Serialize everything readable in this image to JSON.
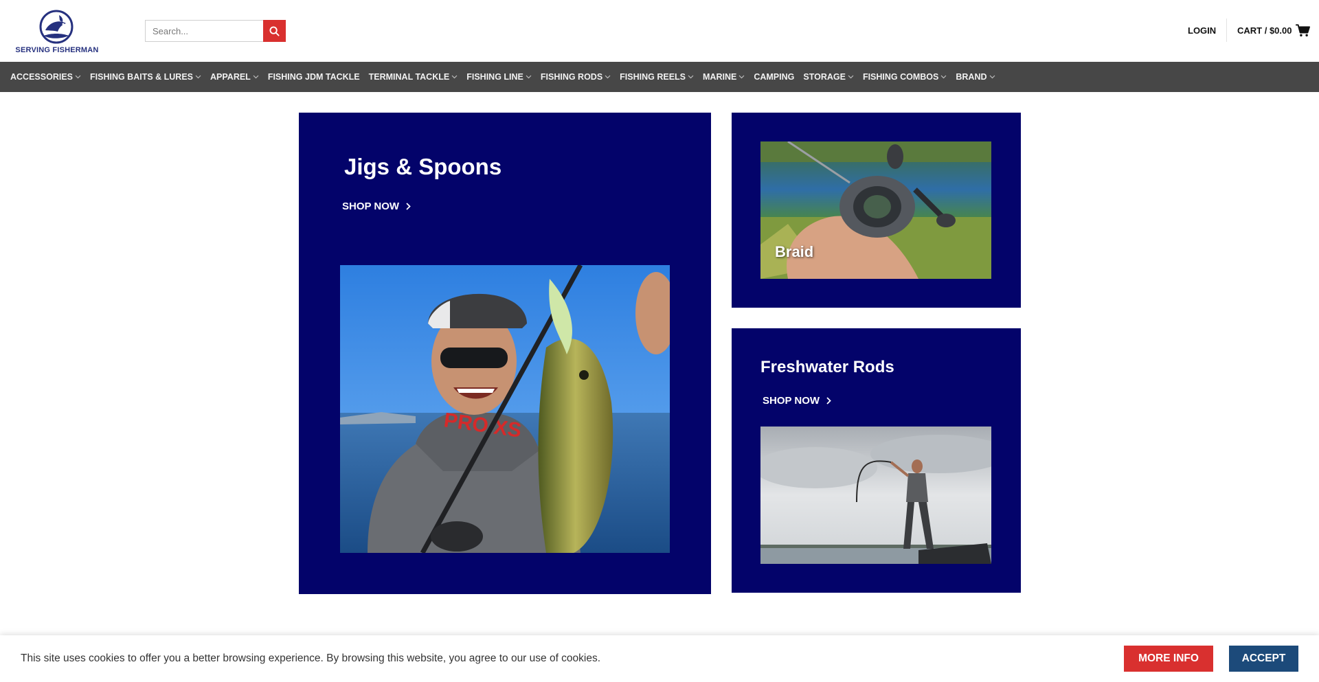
{
  "header": {
    "logo_text": "SERVING FISHERMAN",
    "search": {
      "placeholder": "Search..."
    },
    "login_label": "LOGIN",
    "cart_label": "CART / $0.00"
  },
  "nav": {
    "items": [
      {
        "label": "ACCESSORIES",
        "has_dropdown": true
      },
      {
        "label": "FISHING BAITS & LURES",
        "has_dropdown": true
      },
      {
        "label": "APPAREL",
        "has_dropdown": true
      },
      {
        "label": "FISHING JDM TACKLE",
        "has_dropdown": false
      },
      {
        "label": "TERMINAL TACKLE",
        "has_dropdown": true
      },
      {
        "label": "FISHING LINE",
        "has_dropdown": true
      },
      {
        "label": "FISHING RODS",
        "has_dropdown": true
      },
      {
        "label": "FISHING REELS",
        "has_dropdown": true
      },
      {
        "label": "MARINE",
        "has_dropdown": true
      },
      {
        "label": "CAMPING",
        "has_dropdown": false
      },
      {
        "label": "STORAGE",
        "has_dropdown": true
      },
      {
        "label": "FISHING COMBOS",
        "has_dropdown": true
      },
      {
        "label": "BRAND",
        "has_dropdown": true
      }
    ]
  },
  "promos": {
    "jigs": {
      "title": "Jigs & Spoons",
      "cta": "SHOP NOW"
    },
    "braid": {
      "title": "Braid"
    },
    "rods": {
      "title": "Freshwater Rods",
      "cta": "SHOP NOW"
    }
  },
  "cookie": {
    "message": "This site uses cookies to offer you a better browsing experience. By browsing this website, you agree to our use of cookies.",
    "more_info_label": "MORE INFO",
    "accept_label": "ACCEPT"
  },
  "colors": {
    "accent_red": "#d9302f",
    "card_navy": "#03036a",
    "nav_bg": "#474747",
    "accept_blue": "#1c4a7a",
    "logo_blue": "#26317f"
  }
}
